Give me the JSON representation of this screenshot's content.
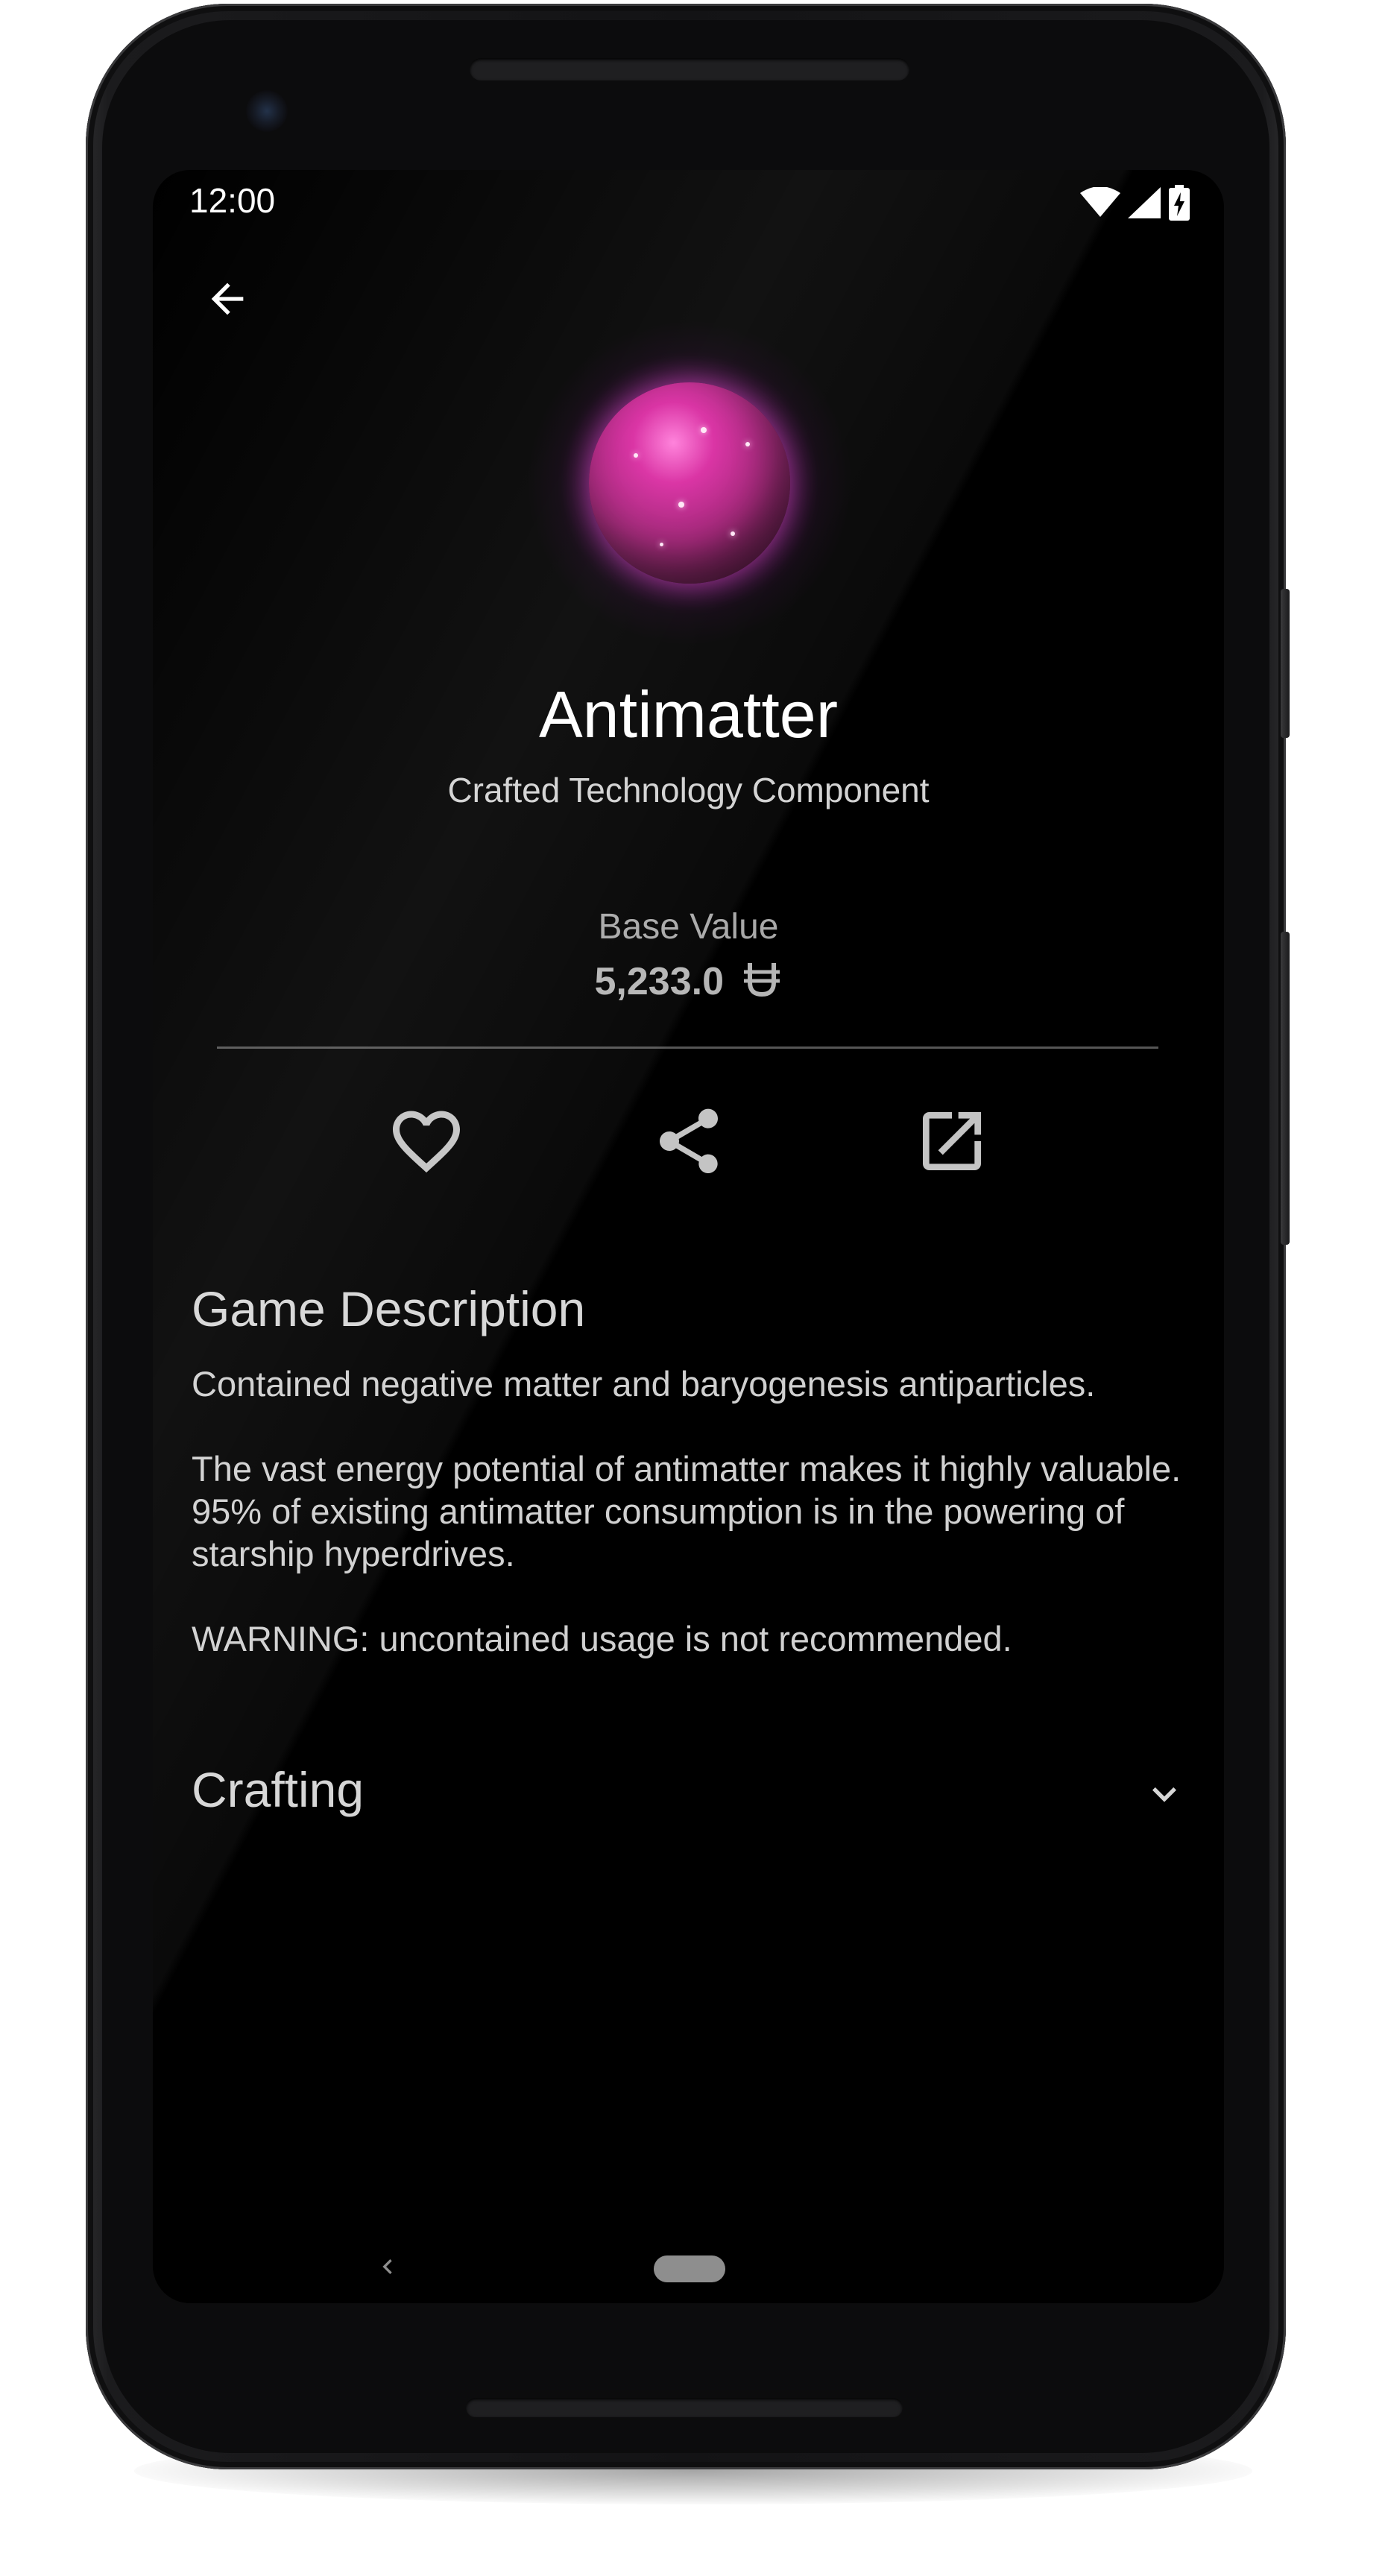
{
  "status_bar": {
    "time": "12:00"
  },
  "item": {
    "name": "Antimatter",
    "category": "Crafted Technology Component",
    "base_value_label": "Base Value",
    "base_value": "5,233.0",
    "currency_icon": "units-currency-icon"
  },
  "actions": {
    "favorite_icon": "heart-outline-icon",
    "share_icon": "share-icon",
    "open_external_icon": "open-external-icon"
  },
  "description": {
    "heading": "Game Description",
    "paragraphs": [
      "Contained negative matter and baryogenesis antiparticles.",
      "The vast energy potential of antimatter makes it highly valuable. 95% of existing antimatter consumption is in the powering of starship hyperdrives.",
      "WARNING: uncontained usage is not recommended."
    ]
  },
  "crafting": {
    "heading": "Crafting",
    "expand_icon": "chevron-down-icon"
  },
  "colors": {
    "background": "#000000",
    "text_primary": "#ffffff",
    "text_secondary": "#d0d0d0",
    "icon_gray": "#c4c4c4",
    "orb_accent": "#d8279f"
  }
}
